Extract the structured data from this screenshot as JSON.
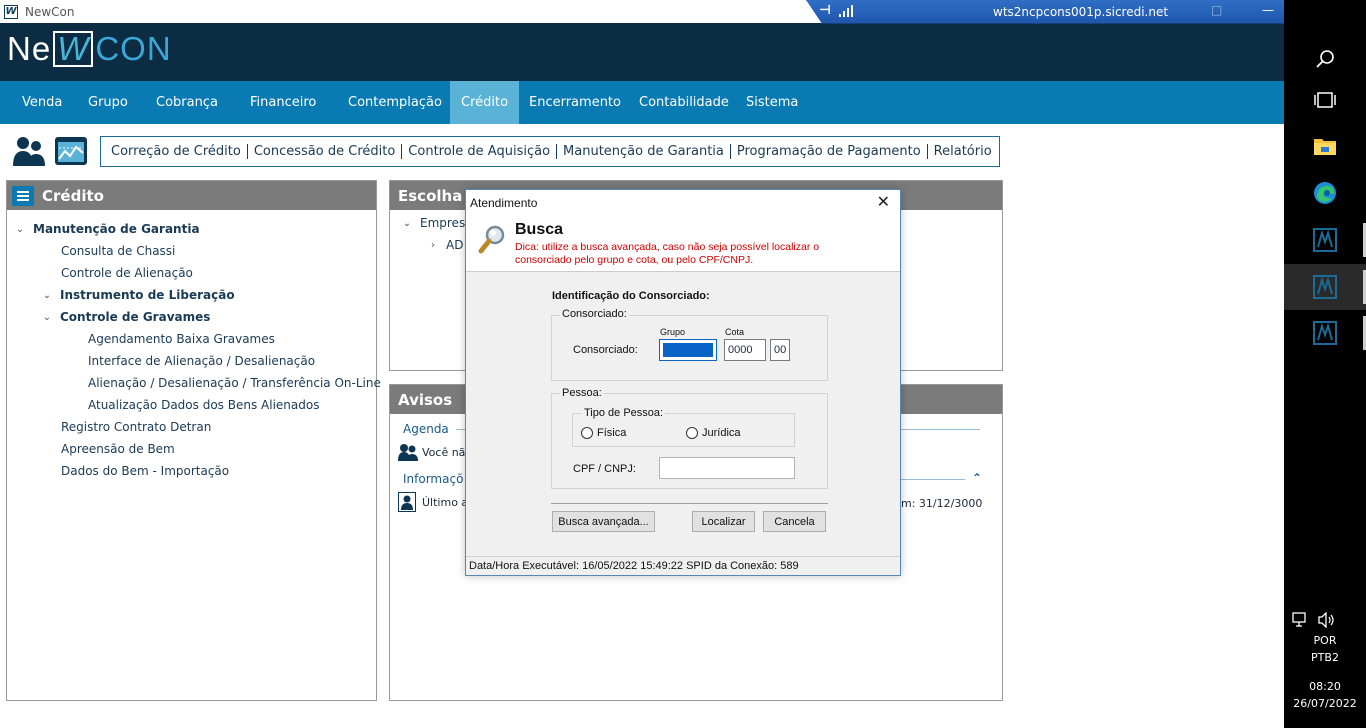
{
  "window": {
    "title": "NewCon"
  },
  "rdp": {
    "host": "wts2ncpcons001p.sicredi.net"
  },
  "logo": {
    "part1": "Ne",
    "part2": "W",
    "part3": "CON"
  },
  "nav": {
    "items": [
      "Venda",
      "Grupo",
      "Cobrança",
      "Financeiro",
      "Contemplação",
      "Crédito",
      "Encerramento",
      "Contabilidade",
      "Sistema"
    ],
    "active": "Crédito"
  },
  "submenu": {
    "items": [
      "Correção de Crédito",
      "Concessão de Crédito",
      "Controle de Aquisição",
      "Manutenção de Garantia",
      "Programação de Pagamento",
      "Relatório"
    ]
  },
  "left_panel": {
    "title": "Crédito",
    "tree": [
      {
        "label": "Manutenção de Garantia",
        "level": 0,
        "bold": true,
        "expanded": true
      },
      {
        "label": "Consulta de Chassi",
        "level": 1
      },
      {
        "label": "Controle de Alienação",
        "level": 1
      },
      {
        "label": "Instrumento de Liberação",
        "level": 1,
        "bold": true,
        "expanded": true
      },
      {
        "label": "Controle de Gravames",
        "level": 1,
        "bold": true,
        "expanded": true
      },
      {
        "label": "Agendamento Baixa Gravames",
        "level": 2
      },
      {
        "label": "Interface de Alienação / Desalienação",
        "level": 2
      },
      {
        "label": "Alienação / Desalienação / Transferência On-Line",
        "level": 2
      },
      {
        "label": "Atualização Dados dos Bens Alienados",
        "level": 2
      },
      {
        "label": "Registro Contrato Detran",
        "level": 1
      },
      {
        "label": "Apreensão de Bem",
        "level": 1
      },
      {
        "label": "Dados do Bem - Importação",
        "level": 1
      }
    ]
  },
  "escolha_panel": {
    "title": "Escolha d",
    "row1": "Empres",
    "row2": "AD"
  },
  "avisos_panel": {
    "title": "Avisos",
    "agenda": "Agenda",
    "agenda_msg": "Você nã",
    "info": "Informaçõ",
    "last_access": "Último ac",
    "validity": "m: 31/12/3000"
  },
  "dialog": {
    "title": "Atendimento",
    "heading": "Busca",
    "tip": "Dica: utilize a busca avançada, caso não seja possível localizar o consorciado pelo grupo e cota, ou pelo CPF/CNPJ.",
    "section": "Identificação do Consorciado:",
    "consorciado_group": "Consorciado:",
    "grupo_label": "Grupo",
    "cota_label": "Cota",
    "consorciado_label": "Consorciado:",
    "grupo_value": "",
    "cota_value": "0000",
    "digit_value": "00",
    "pessoa_group": "Pessoa:",
    "tipo_pessoa": "Tipo de Pessoa:",
    "fisica": "Física",
    "juridica": "Jurídica",
    "cpf_label": "CPF / CNPJ:",
    "cpf_value": "",
    "btn_busca": "Busca avançada...",
    "btn_localizar": "Localizar",
    "btn_cancelar": "Cancela",
    "status": "Data/Hora Executável: 16/05/2022  15:49:22 SPID da Conexão: 589"
  },
  "tray": {
    "lang1": "POR",
    "lang2": "PTB2",
    "time": "08:20",
    "date": "26/07/2022"
  },
  "colors": {
    "header": "#0b2c42",
    "nav": "#0a7bb2",
    "nav_active": "#5ab3d6",
    "panel_header": "#7b7b7b",
    "tip": "#d00000"
  }
}
